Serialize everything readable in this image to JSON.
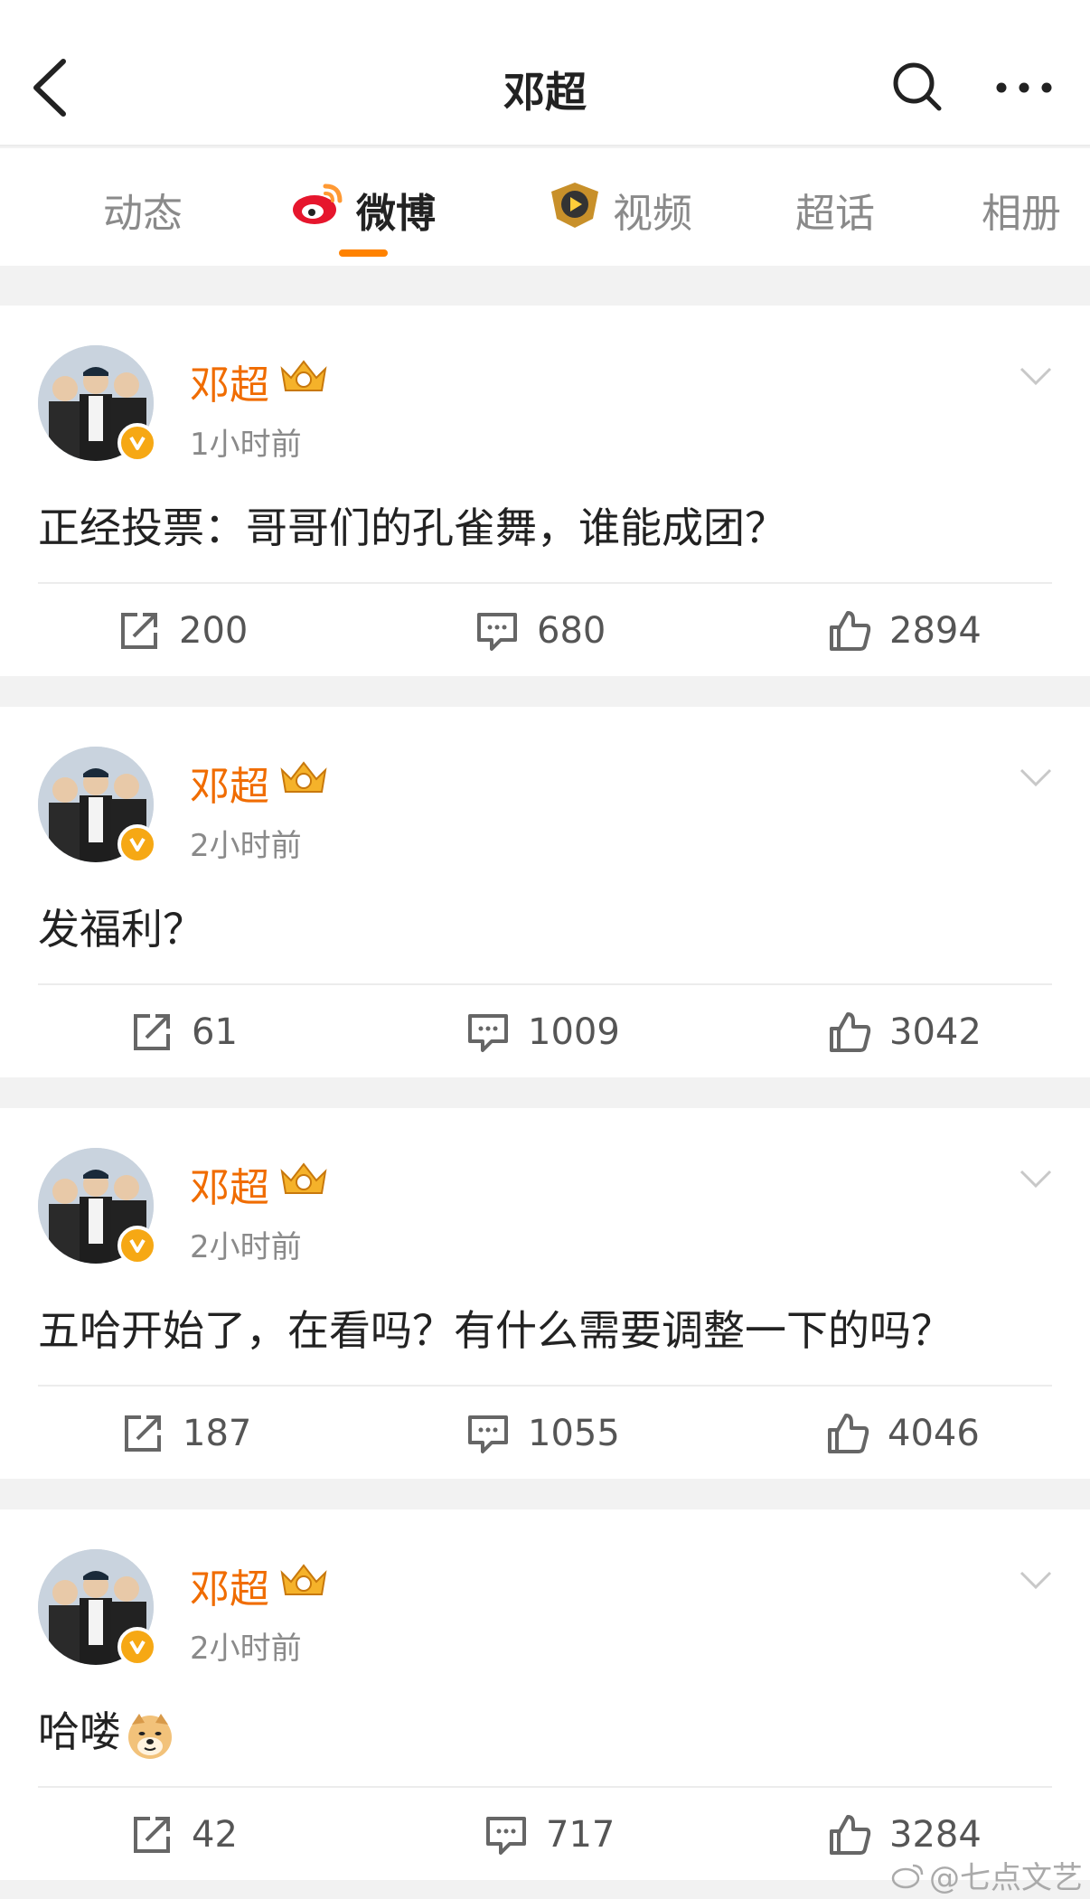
{
  "header": {
    "title": "邓超"
  },
  "tabs": [
    {
      "label": "动态"
    },
    {
      "label": "微博"
    },
    {
      "label": "视频"
    },
    {
      "label": "超话"
    },
    {
      "label": "相册"
    }
  ],
  "posts": [
    {
      "name": "邓超",
      "time": "1小时前",
      "text": "正经投票：哥哥们的孔雀舞，谁能成团？",
      "reposts": "200",
      "comments": "680",
      "likes": "2894"
    },
    {
      "name": "邓超",
      "time": "2小时前",
      "text": "发福利？",
      "reposts": "61",
      "comments": "1009",
      "likes": "3042"
    },
    {
      "name": "邓超",
      "time": "2小时前",
      "text": "五哈开始了，在看吗？有什么需要调整一下的吗？",
      "reposts": "187",
      "comments": "1055",
      "likes": "4046"
    },
    {
      "name": "邓超",
      "time": "2小时前",
      "text": "哈喽",
      "emoji": "doge-emoji",
      "reposts": "42",
      "comments": "717",
      "likes": "3284"
    }
  ],
  "watermark": "@七点文艺",
  "colors": {
    "accent": "#ff8200",
    "name": "#f06c00",
    "badge": "#f6a814"
  }
}
